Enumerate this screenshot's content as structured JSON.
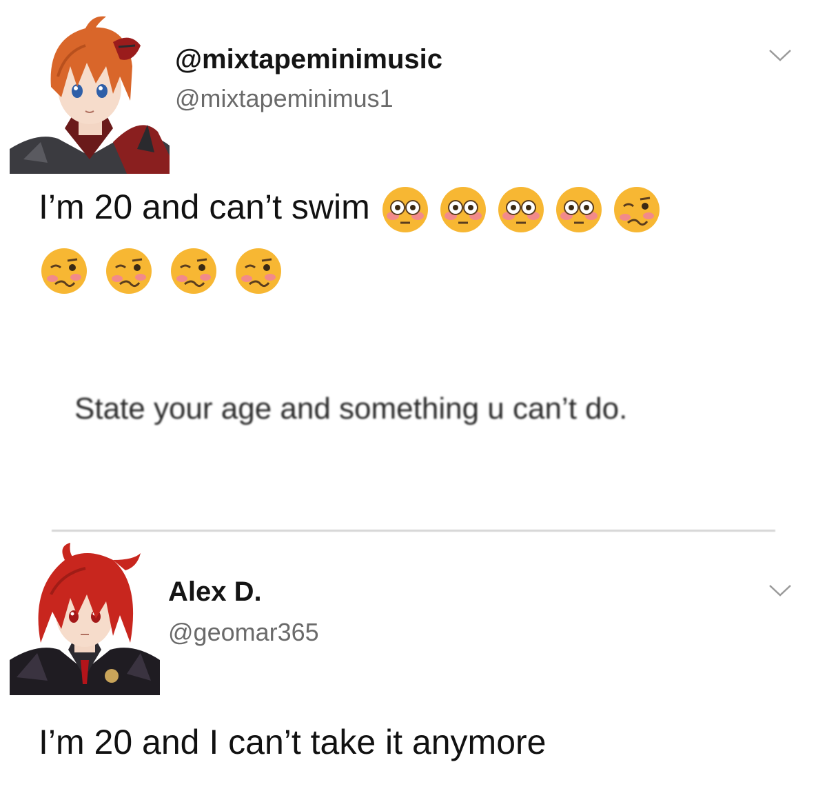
{
  "tweet1": {
    "display_name": "@mixtapeminimusic",
    "handle": "@mixtapeminimus1",
    "text": "I’m 20 and can’t swim",
    "emojis_line1": [
      "flushed-face",
      "flushed-face",
      "flushed-face",
      "flushed-face",
      "woozy-face"
    ],
    "emojis_line2": [
      "woozy-face",
      "woozy-face",
      "woozy-face",
      "woozy-face"
    ]
  },
  "quoted": {
    "text": "State your age and something u can’t do."
  },
  "tweet2": {
    "display_name": "Alex D.",
    "handle": "@geomar365",
    "text": "I’m 20 and I can’t take it anymore"
  },
  "colors": {
    "handle_gray": "#6a6a6a",
    "emoji_yellow": "#f7b733",
    "flush_pink": "#f28a8a",
    "hair_orange": "#d9662a",
    "hair_red": "#c8261e"
  },
  "icons": {
    "menu_chevron": "chevron-down-icon"
  }
}
